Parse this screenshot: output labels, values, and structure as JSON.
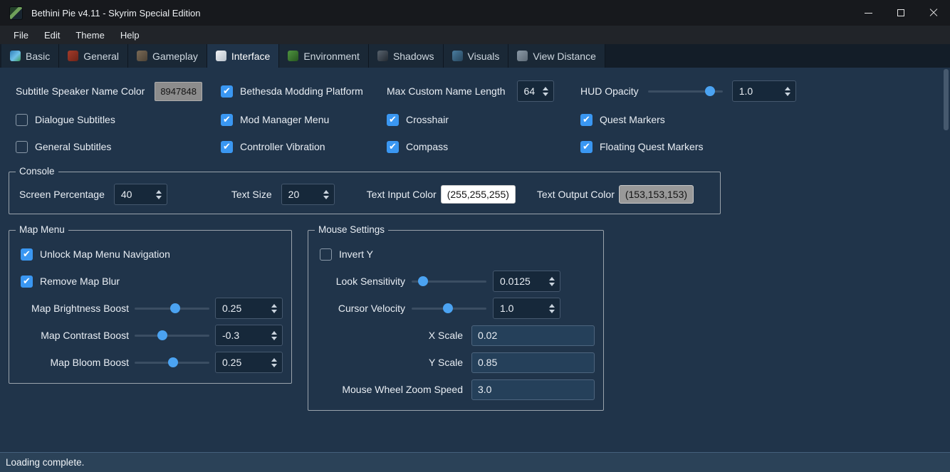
{
  "colors": {
    "accent": "#3a97f2",
    "speaker_color_value_bg": "#8c8c8c",
    "text_input_color_bg": "#ffffff",
    "text_output_color_bg": "#999999"
  },
  "window": {
    "title": "Bethini Pie v4.11 - Skyrim Special Edition"
  },
  "menubar": {
    "items": [
      "File",
      "Edit",
      "Theme",
      "Help"
    ]
  },
  "tabs": [
    {
      "label": "Basic",
      "active": false
    },
    {
      "label": "General",
      "active": false
    },
    {
      "label": "Gameplay",
      "active": false
    },
    {
      "label": "Interface",
      "active": true
    },
    {
      "label": "Environment",
      "active": false
    },
    {
      "label": "Shadows",
      "active": false
    },
    {
      "label": "Visuals",
      "active": false
    },
    {
      "label": "View Distance",
      "active": false
    }
  ],
  "interface": {
    "subtitle_speaker": {
      "label": "Subtitle Speaker Name Color",
      "value": "8947848"
    },
    "max_custom_name_length": {
      "label": "Max Custom Name Length",
      "value": "64"
    },
    "hud_opacity": {
      "label": "HUD Opacity",
      "value": "1.0",
      "percent": 88
    },
    "checkboxes": {
      "dialogue_subtitles": {
        "label": "Dialogue Subtitles",
        "checked": false
      },
      "general_subtitles": {
        "label": "General Subtitles",
        "checked": false
      },
      "bethesda_modding_platform": {
        "label": "Bethesda Modding Platform",
        "checked": true
      },
      "mod_manager_menu": {
        "label": "Mod Manager Menu",
        "checked": true
      },
      "controller_vibration": {
        "label": "Controller Vibration",
        "checked": true
      },
      "crosshair": {
        "label": "Crosshair",
        "checked": true
      },
      "compass": {
        "label": "Compass",
        "checked": true
      },
      "quest_markers": {
        "label": "Quest Markers",
        "checked": true
      },
      "floating_quest_markers": {
        "label": "Floating Quest Markers",
        "checked": true
      }
    },
    "console": {
      "title": "Console",
      "screen_percentage": {
        "label": "Screen Percentage",
        "value": "40"
      },
      "text_size": {
        "label": "Text Size",
        "value": "20"
      },
      "text_input_color": {
        "label": "Text Input Color",
        "value": "(255,255,255)"
      },
      "text_output_color": {
        "label": "Text Output Color",
        "value": "(153,153,153)"
      }
    },
    "map_menu": {
      "title": "Map Menu",
      "unlock_map_menu_navigation": {
        "label": "Unlock Map Menu Navigation",
        "checked": true
      },
      "remove_map_blur": {
        "label": "Remove Map Blur",
        "checked": true
      },
      "map_brightness_boost": {
        "label": "Map Brightness Boost",
        "value": "0.25",
        "percent": 55
      },
      "map_contrast_boost": {
        "label": "Map Contrast Boost",
        "value": "-0.3",
        "percent": 35
      },
      "map_bloom_boost": {
        "label": "Map Bloom Boost",
        "value": "0.25",
        "percent": 52
      }
    },
    "mouse_settings": {
      "title": "Mouse Settings",
      "invert_y": {
        "label": "Invert Y",
        "checked": false
      },
      "look_sensitivity": {
        "label": "Look Sensitivity",
        "value": "0.0125",
        "percent": 10
      },
      "cursor_velocity": {
        "label": "Cursor Velocity",
        "value": "1.0",
        "percent": 48
      },
      "x_scale": {
        "label": "X Scale",
        "value": "0.02"
      },
      "y_scale": {
        "label": "Y Scale",
        "value": "0.85"
      },
      "mouse_wheel_zoom_speed": {
        "label": "Mouse Wheel Zoom Speed",
        "value": "3.0"
      }
    }
  },
  "statusbar": {
    "text": "Loading complete."
  }
}
